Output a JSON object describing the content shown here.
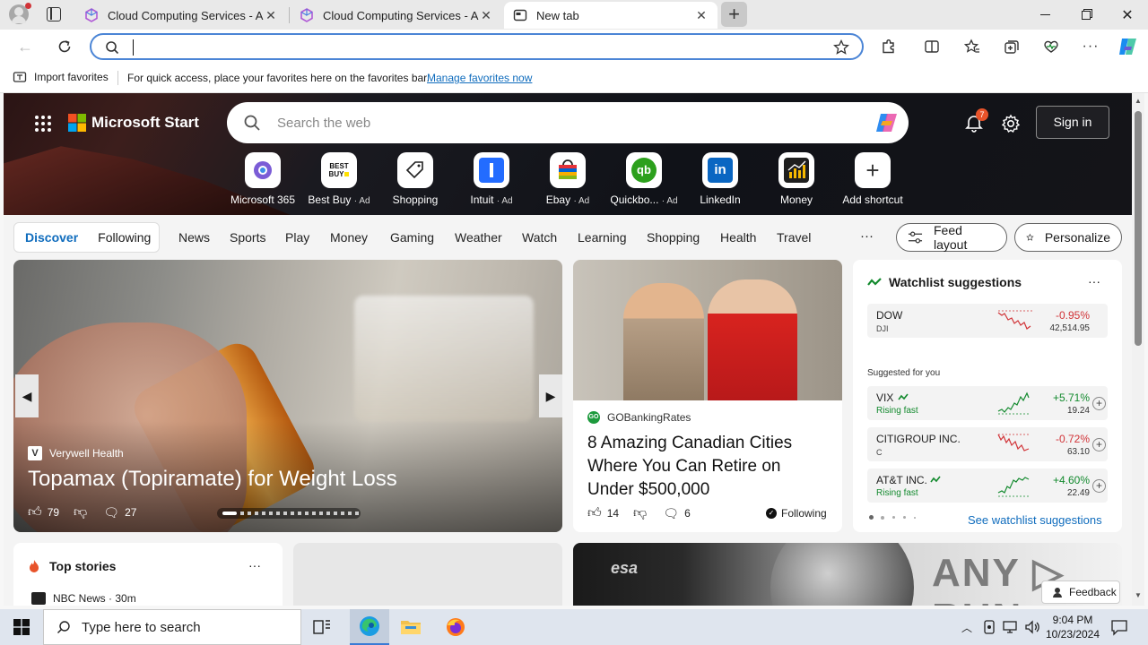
{
  "browser": {
    "tabs": [
      {
        "title": "Cloud Computing Services - Am",
        "active": false
      },
      {
        "title": "Cloud Computing Services - Am",
        "active": false
      },
      {
        "title": "New tab",
        "active": true
      }
    ],
    "address_value": "",
    "favorites_bar": {
      "import_label": "Import favorites",
      "message": "For quick access, place your favorites here on the favorites bar.",
      "manage_link": "Manage favorites now"
    }
  },
  "start": {
    "brand": "Microsoft Start",
    "search_placeholder": "Search the web",
    "notifications_count": "7",
    "sign_in": "Sign in",
    "shortcuts": [
      {
        "label": "Microsoft 365",
        "ad": ""
      },
      {
        "label": "Best Buy",
        "ad": "· Ad"
      },
      {
        "label": "Shopping",
        "ad": ""
      },
      {
        "label": "Intuit",
        "ad": "· Ad"
      },
      {
        "label": "Ebay",
        "ad": "· Ad"
      },
      {
        "label": "Quickbo...",
        "ad": "· Ad"
      },
      {
        "label": "LinkedIn",
        "ad": ""
      },
      {
        "label": "Money",
        "ad": ""
      },
      {
        "label": "Add shortcut",
        "ad": ""
      }
    ],
    "nav": {
      "discover": "Discover",
      "following": "Following",
      "items": [
        "News",
        "Sports",
        "Play",
        "Money",
        "Gaming",
        "Weather",
        "Watch",
        "Learning",
        "Shopping",
        "Health",
        "Travel"
      ],
      "more": "···",
      "feed_layout": "Feed layout",
      "personalize": "Personalize"
    },
    "main_story": {
      "source": "Verywell Health",
      "title": "Topamax (Topiramate) for Weight Loss",
      "likes": "79",
      "comments": "27"
    },
    "story2": {
      "source": "GOBankingRates",
      "title": "8 Amazing Canadian Cities Where You Can Retire on Under $500,000",
      "likes": "14",
      "comments": "6",
      "following": "Following"
    },
    "watchlist": {
      "title": "Watchlist suggestions",
      "more": "···",
      "dow": {
        "name": "DOW",
        "sub": "DJI",
        "pct": "-0.95%",
        "value": "42,514.95",
        "color": "#d13438"
      },
      "suggested_label": "Suggested for you",
      "suggested": [
        {
          "name": "VIX",
          "sub": "Rising fast",
          "pct": "+5.71%",
          "value": "19.24",
          "color": "#138a2e"
        },
        {
          "name": "CITIGROUP INC.",
          "sub": "C",
          "pct": "-0.72%",
          "value": "63.10",
          "color": "#d13438"
        },
        {
          "name": "AT&T INC.",
          "sub": "Rising fast",
          "pct": "+4.60%",
          "value": "22.49",
          "color": "#138a2e"
        }
      ],
      "see_link": "See watchlist suggestions"
    },
    "top_stories": {
      "title": "Top stories",
      "more": "···",
      "first_source": "NBC News · 30m"
    },
    "esa_label": "esa",
    "feedback": "Feedback"
  },
  "taskbar": {
    "search_placeholder": "Type here to search",
    "time": "9:04 PM",
    "date": "10/23/2024"
  },
  "colors": {
    "accent": "#0f6cbd",
    "positive": "#138a2e",
    "negative": "#d13438"
  }
}
